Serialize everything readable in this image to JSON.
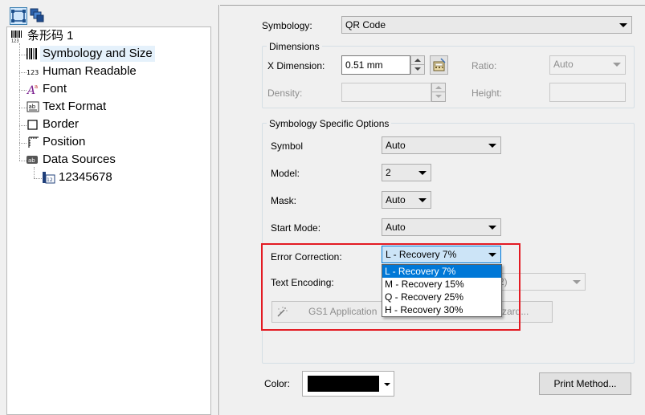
{
  "toolbar": {
    "tree_view_icon": "tree-view-icon",
    "layers_icon": "layers-icon"
  },
  "tree": {
    "root_label": "条形码 1",
    "items": [
      {
        "label": "Symbology and Size",
        "icon": "barcode-icon",
        "selected": true
      },
      {
        "label": "Human Readable",
        "icon": "digits-icon",
        "selected": false
      },
      {
        "label": "Font",
        "icon": "font-icon",
        "selected": false
      },
      {
        "label": "Text Format",
        "icon": "text-format-icon",
        "selected": false
      },
      {
        "label": "Border",
        "icon": "border-icon",
        "selected": false
      },
      {
        "label": "Position",
        "icon": "position-icon",
        "selected": false
      },
      {
        "label": "Data Sources",
        "icon": "data-source-icon",
        "selected": false
      }
    ],
    "data_source_child": "12345678"
  },
  "symbology": {
    "label": "Symbology:",
    "value": "QR Code"
  },
  "dimensions": {
    "group_title": "Dimensions",
    "x_dimension_label": "X Dimension:",
    "x_dimension_value": "0.51 mm",
    "ratio_label": "Ratio:",
    "ratio_value": "Auto",
    "density_label": "Density:",
    "density_value": "",
    "height_label": "Height:",
    "height_value": ""
  },
  "options": {
    "group_title": "Symbology Specific Options",
    "symbol_label": "Symbol",
    "symbol_value": "Auto",
    "model_label": "Model:",
    "model_value": "2",
    "mask_label": "Mask:",
    "mask_value": "Auto",
    "start_mode_label": "Start Mode:",
    "start_mode_value": "Auto",
    "error_correction_label": "Error Correction:",
    "error_correction_value": "L - Recovery 7%",
    "error_correction_options": [
      "L - Recovery 7%",
      "M - Recovery 15%",
      "Q - Recovery 25%",
      "H - Recovery 30%"
    ],
    "text_encoding_label": "Text Encoding:",
    "text_encoding_partial": "2)",
    "gs1_button_label": "GS1 Application",
    "wizard_button_partial": "zard..."
  },
  "bottom": {
    "color_label": "Color:",
    "color_value": "#000000",
    "print_method_label": "Print Method..."
  },
  "colors": {
    "highlight": "#e31b23",
    "selection": "#0078d7"
  }
}
